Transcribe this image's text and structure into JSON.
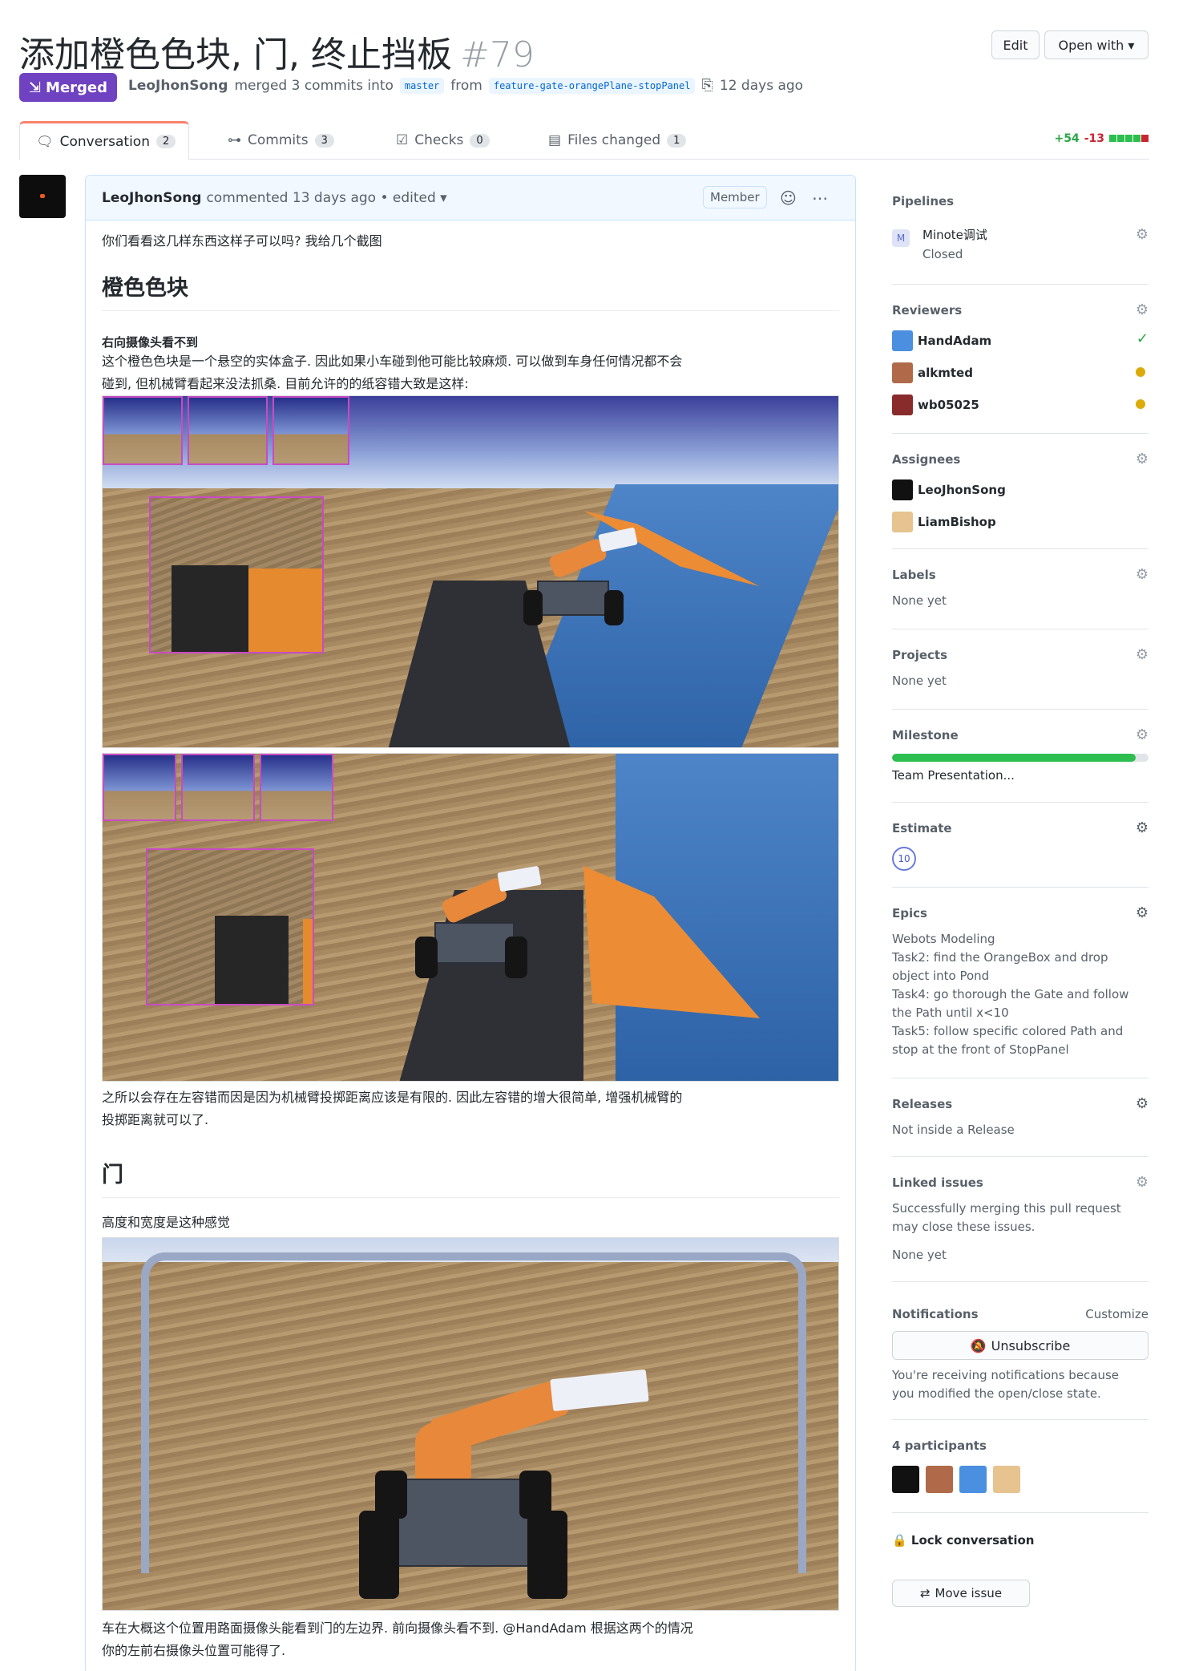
{
  "header": {
    "title": "添加橙色色块, 门, 终止挡板",
    "number": "#79",
    "edit_label": "Edit",
    "open_with_label": "Open with ▾",
    "state_label": "Merged",
    "author": "LeoJhonSong",
    "merge_text": "merged 3 commits into",
    "base_branch": "master",
    "from_text": "from",
    "head_branch": "feature-gate-orangePlane-stopPanel",
    "time": "12 days ago"
  },
  "tabs": [
    {
      "label": "Conversation",
      "count": "2"
    },
    {
      "label": "Commits",
      "count": "3"
    },
    {
      "label": "Checks",
      "count": "0"
    },
    {
      "label": "Files changed",
      "count": "1"
    }
  ],
  "diffstat": {
    "additions": "+54",
    "deletions": "-13"
  },
  "comment": {
    "author": "LeoJhonSong",
    "meta": "commented 13 days ago • edited ▾",
    "role": "Member",
    "intro": "你们看看这几样东西这样子可以吗? 我给几个截图",
    "section1_title": "橙色色块",
    "section1_sub": "右向摄像头看不到",
    "section1_p1": "这个橙色色块是一个悬空的实体盒子. 因此如果小车碰到他可能比较麻烦. 可以做到车身任何情况都不会",
    "section1_p2": "碰到, 但机械臂看起来没法抓桑. 目前允许的的纸容错大致是这样:",
    "section1_after1": "之所以会存在左容错而因是因为机械臂投掷距离应该是有限的. 因此左容错的增大很简单, 增强机械臂的",
    "section1_after2": "投掷距离就可以了.",
    "section2_title": "门",
    "section2_sub": "高度和宽度是这种感觉",
    "section2_after1": "车在大概这个位置用路面摄像头能看到门的左边界. 前向摄像头看不到. @HandAdam 根据这两个的情况",
    "section2_after2": "你的左前右摄像头位置可能得了."
  },
  "sidebar": {
    "pipelines_title": "Pipelines",
    "pipeline_name": "Minote调试",
    "pipeline_status": "Closed",
    "reviewers_title": "Reviewers",
    "reviewers": [
      "HandAdam",
      "alkmted",
      "wb05025"
    ],
    "assignees_title": "Assignees",
    "assignees": [
      "LeoJhonSong",
      "LiamBishop"
    ],
    "labels_title": "Labels",
    "labels_value": "None yet",
    "projects_title": "Projects",
    "projects_value": "None yet",
    "milestone_title": "Milestone",
    "milestone_value": "Team Presentation...",
    "milestone_progress": 0.95,
    "estimate_title": "Estimate",
    "estimate_value": "10",
    "epics_title": "Epics",
    "epics_lines": [
      "Webots Modeling",
      "Task2: find the OrangeBox and drop",
      "object into Pond",
      "Task4: go thorough the Gate and follow",
      "the Path until x<10",
      "Task5: follow specific colored Path and",
      "stop at the front of StopPanel"
    ],
    "releases_title": "Releases",
    "releases_value": "Not inside a Release",
    "linked_title": "Linked issues",
    "linked_lines": [
      "Successfully merging this pull request",
      "may close these issues."
    ],
    "linked_value": "None yet",
    "notifications_title": "Notifications",
    "customize_label": "Customize",
    "unsubscribe_label": "Unsubscribe",
    "notif_lines": [
      "You're receiving notifications because",
      "you modified the open/close state."
    ],
    "participants_title": "4 participants",
    "lock_label": "Lock conversation",
    "move_label": "Move issue"
  },
  "colors": {
    "merged": "#6f42c1",
    "accent": "#0366d6",
    "tab_active": "#f9826c",
    "progress": "#2cbe4e"
  }
}
